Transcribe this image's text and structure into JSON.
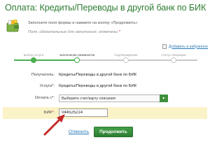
{
  "header": {
    "title": "Оплата: Кредиты/Переводы в другой банк по БИК",
    "instruction": "Заполните поля формы и нажмите на кнопку «Продолжить»",
    "required_note_prefix": "Поля, обязательные для заполнения, отмечены",
    "required_mark": "*",
    "favorites_link": "Добавить в избранное"
  },
  "steps": [
    {
      "label": "выбор услуги",
      "state": "done"
    },
    {
      "label": "заполнение реквизитов",
      "state": "active"
    },
    {
      "label": "подтверждение",
      "state": "pending"
    },
    {
      "label": "статус операции",
      "state": "pending"
    }
  ],
  "form": {
    "recipient_label": "Получатель:",
    "recipient_value": "Кредиты/Переводы в другой банк по БИК",
    "service_label": "Услуга*:",
    "service_value": "Кредиты/Переводы в другой банк по БИК",
    "pay_from_label": "Оплата с*:",
    "pay_from_placeholder": "Выберите счет/карту списания",
    "bik_label": "БИК",
    "bik_value": "044525214"
  },
  "actions": {
    "cancel_label": "Отменить",
    "continue_label": "Продолжить"
  },
  "colors": {
    "title": "#2e7d32",
    "accent_green": "#43a047",
    "link_blue": "#2b7bb9",
    "highlight_row": "#fbf3c8",
    "annotation_arrow": "#c62828"
  }
}
